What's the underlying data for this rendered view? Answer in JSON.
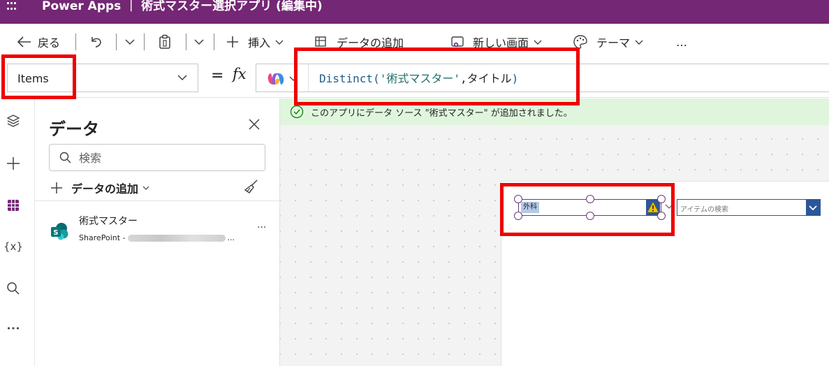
{
  "app": {
    "title": "Power Apps ｜ 術式マスター選択アプリ (編集中)"
  },
  "toolbar": {
    "back_label": "戻る",
    "insert_label": "挿入",
    "add_data_label": "データの追加",
    "new_screen_label": "新しい画面",
    "theme_label": "テーマ",
    "more_label": "…"
  },
  "formula_bar": {
    "property": "Items",
    "equals": "=",
    "fx": "fx",
    "formula_fn": "Distinct(",
    "formula_source": "'術式マスター'",
    "formula_sep": ",",
    "formula_field": "タイトル",
    "formula_close": ")"
  },
  "left_rail": {
    "variables_label": "{x}",
    "more_label": "•••"
  },
  "data_panel": {
    "title": "データ",
    "search_placeholder": "検索",
    "add_data_label": "データの追加",
    "sources": [
      {
        "name": "術式マスター",
        "type": "SharePoint -",
        "type_suffix": "...",
        "more": "···"
      }
    ]
  },
  "canvas": {
    "banner": "このアプリにデータ ソース \"術式マスター\" が追加されました。",
    "dropdown_value": "外科",
    "combo_placeholder": "アイテムの検索"
  },
  "colors": {
    "brand": "#742774",
    "annotation": "#ee0000",
    "banner_bg": "#dff6dd",
    "control_blue": "#2b579a"
  }
}
